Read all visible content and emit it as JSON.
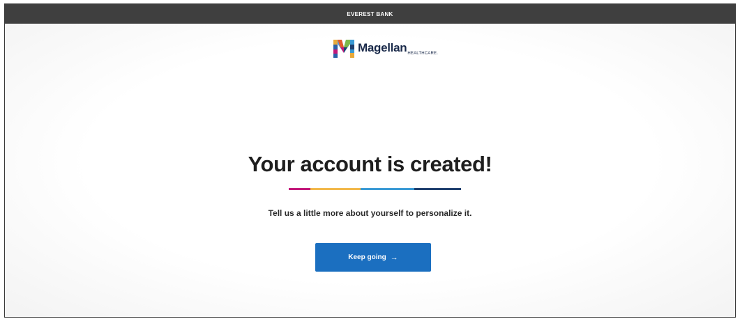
{
  "header": {
    "bank_name": "EVEREST BANK"
  },
  "logo": {
    "name": "Magellan",
    "subname": "HEALTHCARE.",
    "icon": "magellan-m-logo-icon"
  },
  "main": {
    "title": "Your account is created!",
    "subtitle": "Tell us a little more about yourself to personalize it.",
    "cta_label": "Keep going",
    "cta_icon": "arrow-right-icon",
    "cta_arrow": "→",
    "divider_colors": [
      "#c2187a",
      "#f2b84a",
      "#3a9ad5",
      "#1f3f6e"
    ]
  },
  "colors": {
    "topbar": "#3f3f3f",
    "button": "#1b6fc0",
    "heading": "#1e1e1e"
  }
}
